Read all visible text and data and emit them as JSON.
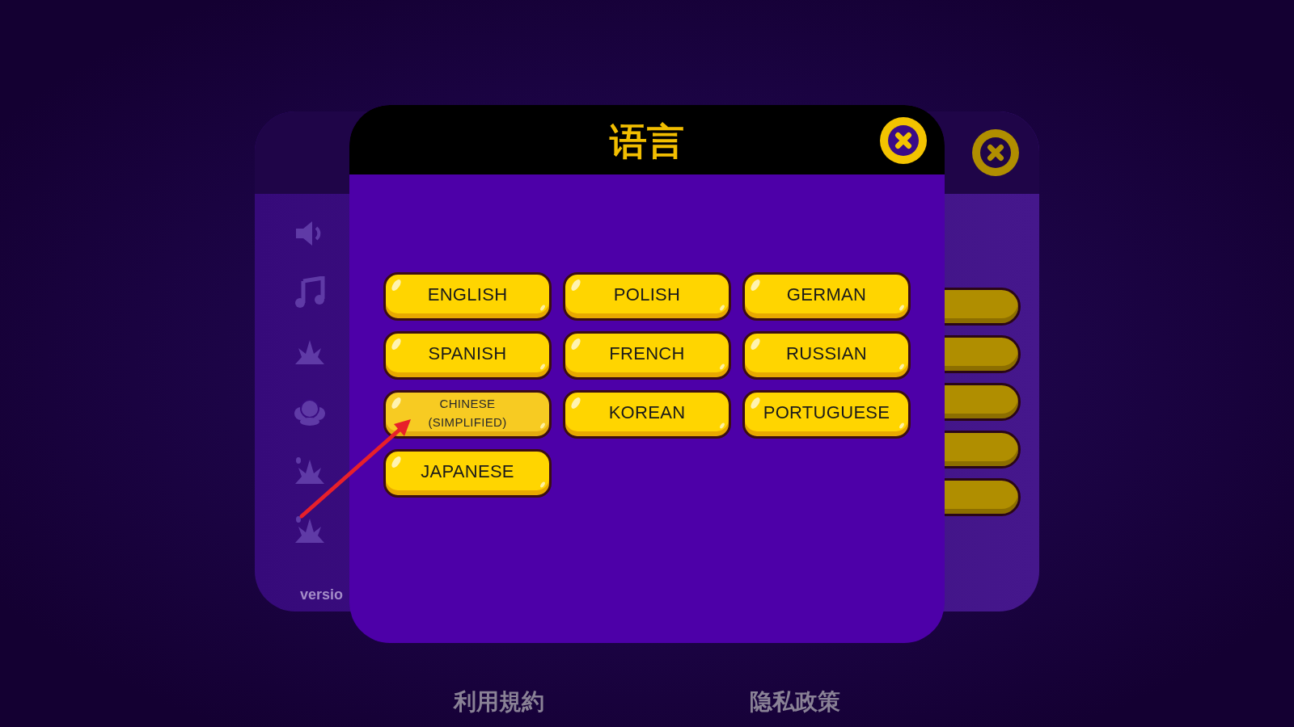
{
  "background_panel": {
    "version_label": "versio"
  },
  "dialog": {
    "title": "语言",
    "languages": [
      {
        "label": "ENGLISH",
        "selected": false
      },
      {
        "label": "POLISH",
        "selected": false
      },
      {
        "label": "GERMAN",
        "selected": false
      },
      {
        "label": "SPANISH",
        "selected": false
      },
      {
        "label": "FRENCH",
        "selected": false
      },
      {
        "label": "RUSSIAN",
        "selected": false
      },
      {
        "label": "CHINESE (SIMPLIFIED)",
        "selected": true
      },
      {
        "label": "KOREAN",
        "selected": false
      },
      {
        "label": "PORTUGUESE",
        "selected": false
      },
      {
        "label": "JAPANESE",
        "selected": false
      }
    ]
  },
  "footer_links": [
    {
      "label": "利用規約"
    },
    {
      "label": "隐私政策"
    }
  ]
}
